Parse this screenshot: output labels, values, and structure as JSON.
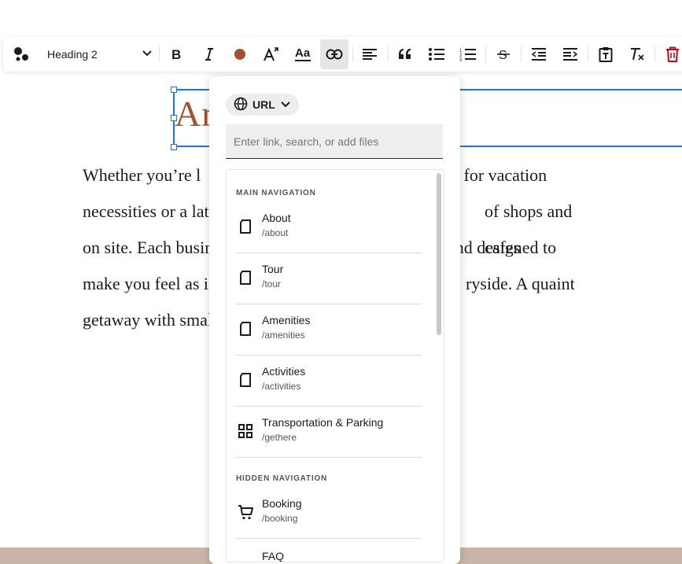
{
  "toolbar": {
    "text_style": "Heading 2",
    "text_color": "#a0522d"
  },
  "document": {
    "heading_visible": "Ar",
    "body_lines": [
      "Whether you’re l",
      "necessities or a late-",
      "on site. Each busine",
      "make you feel as if y",
      "getaway with small"
    ],
    "body_lines_right": [
      "g for vacation",
      "of shops and cafes",
      "and designed to",
      "ryside. A quaint",
      ""
    ]
  },
  "link_popover": {
    "type_label": "URL",
    "input_placeholder": "Enter link, search, or add files",
    "input_value": "",
    "sections": [
      {
        "label": "MAIN NAVIGATION",
        "items": [
          {
            "title": "About",
            "path": "/about",
            "icon": "page-icon"
          },
          {
            "title": "Tour",
            "path": "/tour",
            "icon": "page-icon"
          },
          {
            "title": "Amenities",
            "path": "/amenities",
            "icon": "page-icon"
          },
          {
            "title": "Activities",
            "path": "/activities",
            "icon": "page-icon"
          },
          {
            "title": "Transportation & Parking",
            "path": "/gethere",
            "icon": "grid-icon"
          }
        ]
      },
      {
        "label": "HIDDEN NAVIGATION",
        "items": [
          {
            "title": "Booking",
            "path": "/booking",
            "icon": "cart-icon"
          },
          {
            "title": "FAQ",
            "path": "",
            "icon": "page-icon"
          }
        ]
      }
    ]
  },
  "colors": {
    "accent": "#1a73e8",
    "heading": "#a0522d",
    "footer": "#c9b6a8"
  }
}
